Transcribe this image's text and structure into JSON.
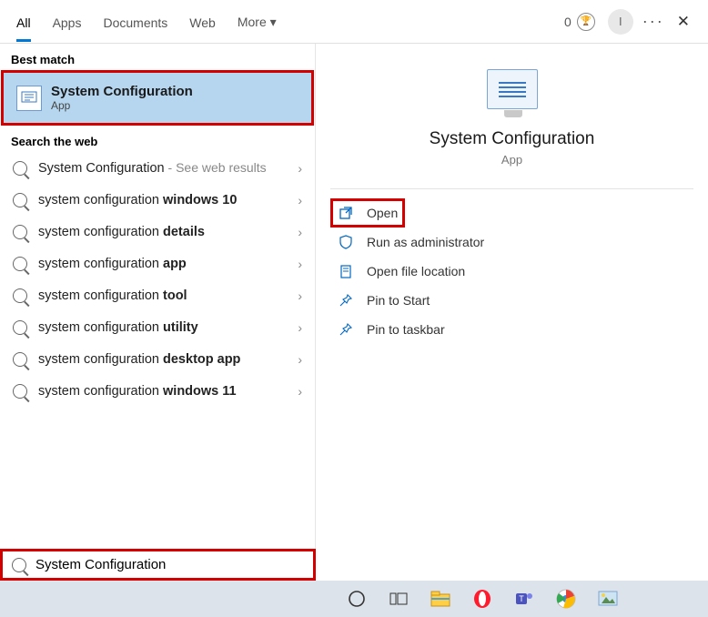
{
  "tabs": {
    "all": "All",
    "apps": "Apps",
    "documents": "Documents",
    "web": "Web",
    "more": "More"
  },
  "header": {
    "reward_points": "0",
    "avatar_initial": "I"
  },
  "sections": {
    "best_match": "Best match",
    "search_web": "Search the web"
  },
  "best_match": {
    "title": "System Configuration",
    "subtitle": "App"
  },
  "web_results": [
    {
      "prefix": "System Configuration",
      "bold": "",
      "hint": " - See web results"
    },
    {
      "prefix": "system configuration ",
      "bold": "windows 10",
      "hint": ""
    },
    {
      "prefix": "system configuration ",
      "bold": "details",
      "hint": ""
    },
    {
      "prefix": "system configuration ",
      "bold": "app",
      "hint": ""
    },
    {
      "prefix": "system configuration ",
      "bold": "tool",
      "hint": ""
    },
    {
      "prefix": "system configuration ",
      "bold": "utility",
      "hint": ""
    },
    {
      "prefix": "system configuration ",
      "bold": "desktop app",
      "hint": ""
    },
    {
      "prefix": "system configuration ",
      "bold": "windows 11",
      "hint": ""
    }
  ],
  "detail": {
    "title": "System Configuration",
    "subtitle": "App"
  },
  "actions": {
    "open": "Open",
    "run_admin": "Run as administrator",
    "open_loc": "Open file location",
    "pin_start": "Pin to Start",
    "pin_taskbar": "Pin to taskbar"
  },
  "search_input": {
    "value": "System Configuration"
  }
}
